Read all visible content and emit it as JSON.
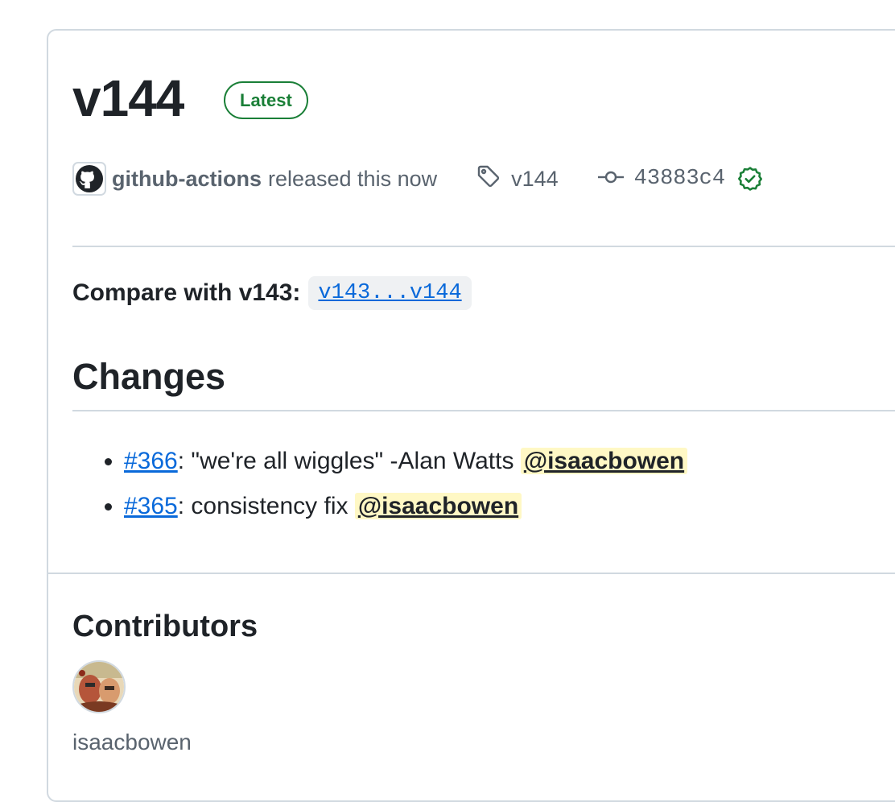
{
  "release": {
    "title": "v144",
    "badge": "Latest",
    "author": "github-actions",
    "released_text": "released this now",
    "tag": "v144",
    "commit": "43883c4"
  },
  "compare": {
    "label": "Compare with v143:",
    "link": "v143...v144"
  },
  "changes": {
    "heading": "Changes",
    "items": [
      {
        "pr": "#366",
        "text": ": \"we're all wiggles\" -Alan Watts ",
        "mention": "@isaacbowen"
      },
      {
        "pr": "#365",
        "text": ": consistency fix ",
        "mention": "@isaacbowen"
      }
    ]
  },
  "contributors": {
    "heading": "Contributors",
    "items": [
      {
        "name": "isaacbowen"
      }
    ]
  },
  "colors": {
    "accent_link": "#0969da",
    "success": "#1a7f37",
    "mention_bg": "#fff8c5",
    "border": "#d1d9e0",
    "muted": "#59636e"
  },
  "icons": {
    "author_avatar": "github-octocat-icon",
    "tag": "tag-icon",
    "commit": "git-commit-icon",
    "verified": "verified-check-icon"
  }
}
